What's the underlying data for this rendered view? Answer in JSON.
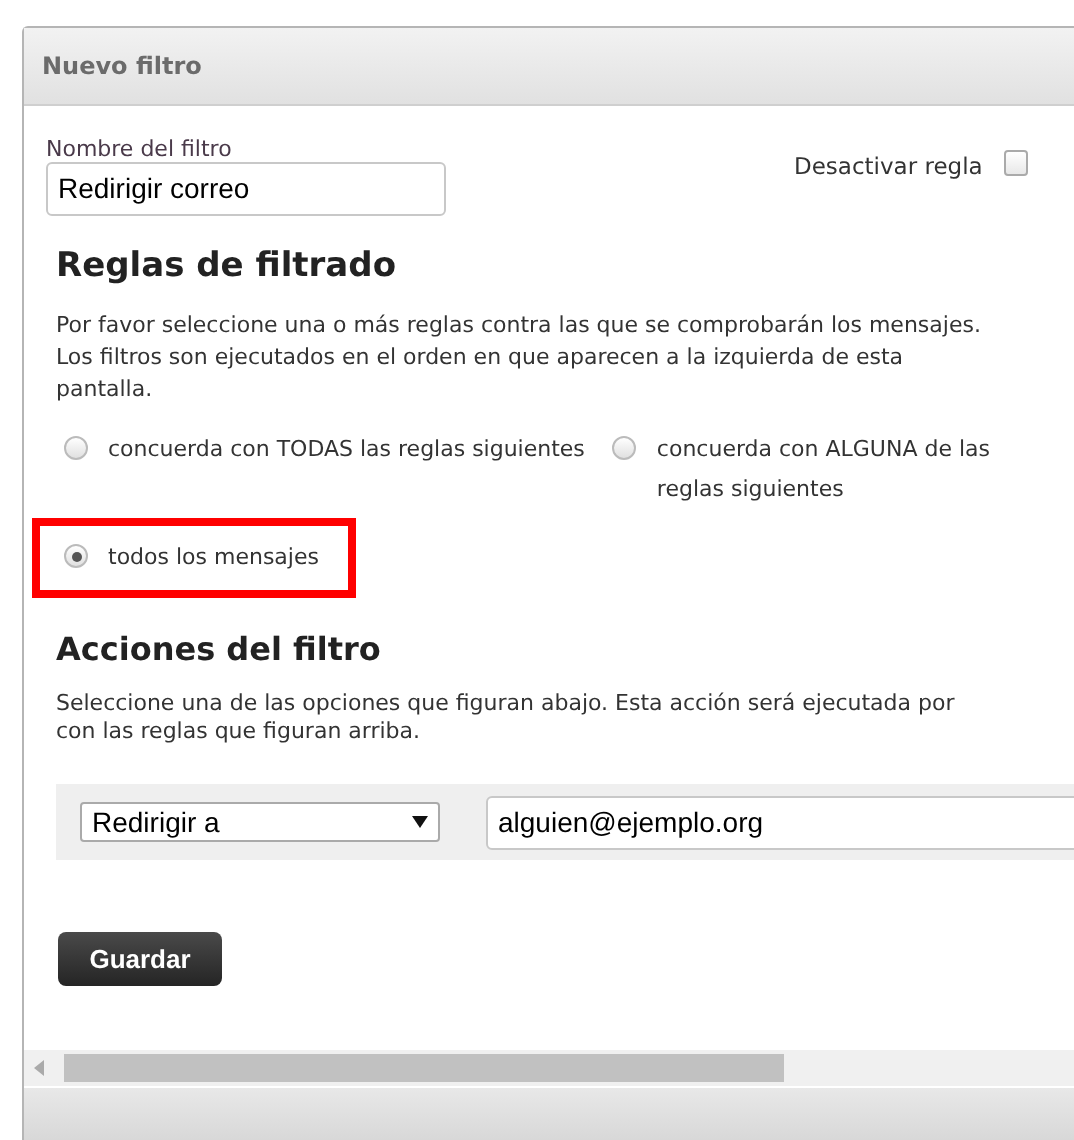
{
  "panel": {
    "title": "Nuevo filtro"
  },
  "filter_name": {
    "label": "Nombre del filtro",
    "value": "Redirigir correo"
  },
  "disable_rule": {
    "label": "Desactivar regla",
    "checked": false
  },
  "rules": {
    "heading": "Reglas de filtrado",
    "description": "Por favor seleccione una o más reglas contra las que se comprobarán los mensajes. Los filtros son ejecutados en el orden en que aparecen a la izquierda de esta pantalla.",
    "options": [
      {
        "label": "concuerda con TODAS las reglas siguientes",
        "selected": false,
        "highlighted": false
      },
      {
        "label": "concuerda con ALGUNA de las reglas siguientes",
        "selected": false,
        "highlighted": false
      },
      {
        "label": "todos los mensajes",
        "selected": true,
        "highlighted": true
      }
    ]
  },
  "actions": {
    "heading": "Acciones del filtro",
    "description_lines": [
      "Seleccione una de las opciones que figuran abajo. Esta acción será ejecutada por",
      "con las reglas que figuran arriba."
    ],
    "action": "Redirigir a",
    "target": "alguien@ejemplo.org"
  },
  "save_button": "Guardar"
}
